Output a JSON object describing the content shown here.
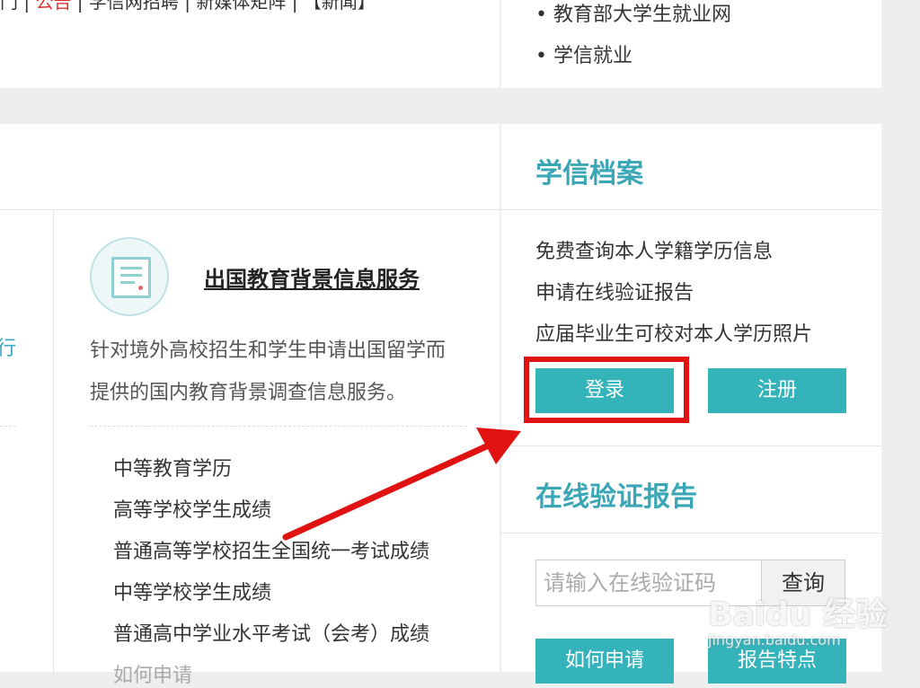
{
  "top_bar": {
    "partial_links": [
      {
        "text": "门 | "
      },
      {
        "text": "公告",
        "color": "#d9342b"
      },
      {
        "text": " | 学信网招聘 | 新媒体矩阵 | 【新闻】"
      }
    ],
    "right_links": [
      "• 教育部大学生就业网",
      "• 学信就业"
    ]
  },
  "service": {
    "title": "出国教育背景信息服务",
    "description_lines": [
      "针对境外高校招生和学生申请出国留学而",
      "提供的国内教育背景调查信息服务。"
    ],
    "items": [
      "中等教育学历",
      "高等学校学生成绩",
      "普通高等学校招生全国统一考试成绩",
      "中等学校学生成绩",
      "普通高中学业水平考试（会考）成绩",
      "如何申请"
    ],
    "cut_off_char": "行"
  },
  "xuexin_archive": {
    "title": "学信档案",
    "lines": [
      "免费查询本人学籍学历信息",
      "申请在线验证报告",
      "应届毕业生可校对本人学历照片"
    ],
    "login_label": "登录",
    "register_label": "注册"
  },
  "online_verify": {
    "title": "在线验证报告",
    "input_placeholder": "请输入在线验证码",
    "query_label": "查询",
    "how_to_apply_label": "如何申请",
    "features_label": "报告特点"
  },
  "watermark": {
    "brand": "Baidu 经验",
    "url": "jingyan.baidu.com"
  },
  "colors": {
    "accent": "#35b3bb",
    "title_teal": "#3ba7b6",
    "annotation_red": "#e01212"
  }
}
